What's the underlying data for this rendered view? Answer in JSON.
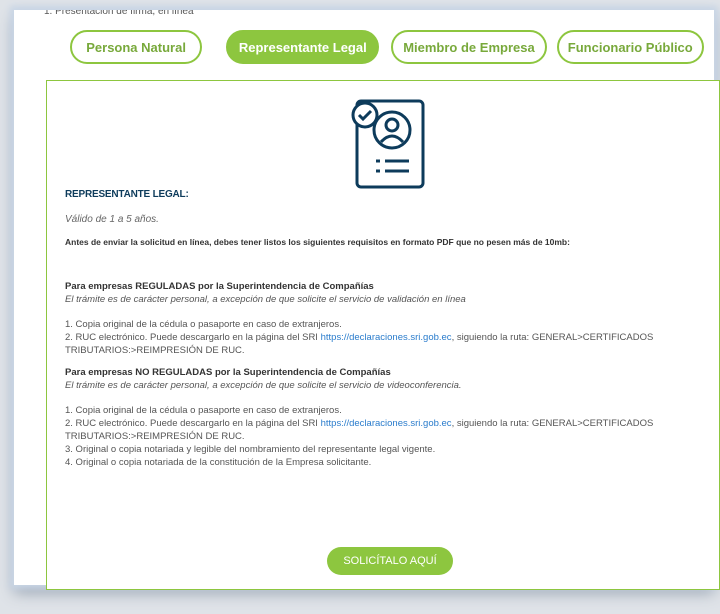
{
  "top_fragment": "1. Presentación de firma, en línea",
  "tabs": [
    {
      "label": "Persona Natural"
    },
    {
      "label": "Representante Legal"
    },
    {
      "label": "Miembro de Empresa"
    },
    {
      "label": "Funcionario Público"
    }
  ],
  "active_tab": 1,
  "panel": {
    "icon": "document-user-check-icon",
    "title": "REPRESENTANTE LEGAL:",
    "validity": "Válido de 1 a 5 años.",
    "intro": "Antes de enviar la solicitud en línea, debes tener listos los siguientes requisitos en formato PDF que no pesen más de 10mb:",
    "regulated": {
      "title": "Para empresas REGULADAS por la Superintendencia de Compañías",
      "subtitle": "El trámite es de carácter personal, a excepción de que solicite el servicio de validación en línea",
      "items": [
        {
          "text": "1. Copia original de la cédula  o pasaporte en caso de extranjeros."
        },
        {
          "prefix": "2. RUC electrónico. Puede descargarlo en la página del SRI ",
          "link": "https://declaraciones.sri.gob.ec",
          "suffix": ", siguiendo la ruta: GENERAL>CERTIFICADOS TRIBUTARIOS:>REIMPRESIÓN DE RUC."
        }
      ]
    },
    "not_regulated": {
      "title": "Para empresas NO REGULADAS por la Superintendencia de Compañías",
      "subtitle": "El trámite es de carácter personal, a excepción de que solicite el servicio de videoconferencia.",
      "items": [
        {
          "text": "1. Copia original de la cédula  o pasaporte en caso de extranjeros."
        },
        {
          "prefix": "2. RUC electrónico. Puede descargarlo en la página del SRI ",
          "link": "https://declaraciones.sri.gob.ec",
          "suffix": ", siguiendo la ruta: GENERAL>CERTIFICADOS TRIBUTARIOS:>REIMPRESIÓN DE RUC."
        },
        {
          "text": "3. Original o copia notariada y legible del nombramiento del representante legal vigente."
        },
        {
          "text": "4. Original o copia notariada de la constitución de la Empresa solicitante."
        }
      ]
    },
    "button_label": "SOLICÍTALO AQUÍ"
  },
  "colors": {
    "accent": "#8dc63f",
    "navy": "#0d3b5b",
    "link": "#2a7ccc"
  }
}
